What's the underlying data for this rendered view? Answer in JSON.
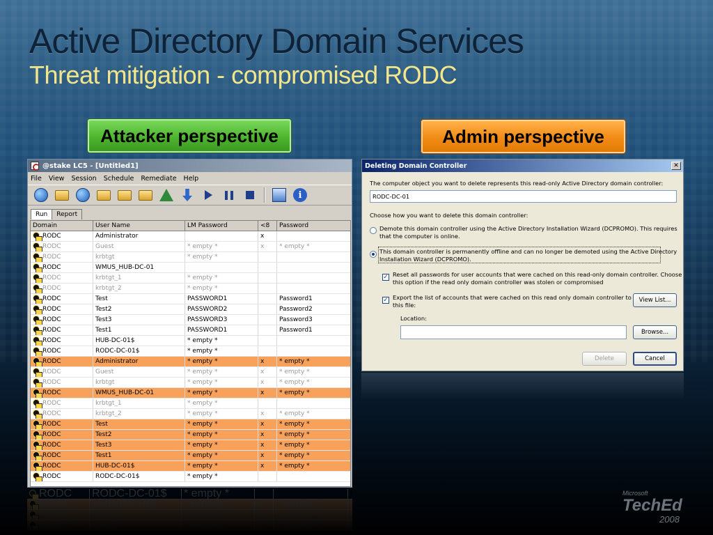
{
  "slide": {
    "title": "Active Directory Domain Services",
    "subtitle": "Threat mitigation - compromised RODC"
  },
  "badges": {
    "attacker": "Attacker perspective",
    "admin": "Admin perspective"
  },
  "colors": {
    "attacker_badge": "#4fb52f",
    "admin_badge": "#f28b16",
    "highlight_row": "#f7a15a"
  },
  "lc5": {
    "title": "@stake LC5 - [Untitled1]",
    "menu": [
      "File",
      "View",
      "Session",
      "Schedule",
      "Remediate",
      "Help"
    ],
    "toolbar_icons": [
      "new-session-icon",
      "open-session-icon",
      "save-icon",
      "import-icon",
      "export-icon",
      "session-options-icon",
      "remediate-icon",
      "download-icon",
      "play-icon",
      "pause-icon",
      "stop-icon",
      "report-icon",
      "info-icon"
    ],
    "tabs": [
      "Run",
      "Report"
    ],
    "columns": [
      "Domain",
      "User Name",
      "LM Password",
      "<8",
      "Password"
    ],
    "rows": [
      {
        "domain": "RODC",
        "user": "Administrator",
        "lm": "",
        "lt8": "x",
        "pw": "",
        "style": "normal"
      },
      {
        "domain": "RODC",
        "user": "Guest",
        "lm": "* empty *",
        "lt8": "x",
        "pw": "* empty *",
        "style": "grey"
      },
      {
        "domain": "RODC",
        "user": "krbtgt",
        "lm": "* empty *",
        "lt8": "",
        "pw": "",
        "style": "grey"
      },
      {
        "domain": "RODC",
        "user": "WMUS_HUB-DC-01",
        "lm": "",
        "lt8": "",
        "pw": "",
        "style": "normal"
      },
      {
        "domain": "RODC",
        "user": "krbtgt_1",
        "lm": "* empty *",
        "lt8": "",
        "pw": "",
        "style": "grey"
      },
      {
        "domain": "RODC",
        "user": "krbtgt_2",
        "lm": "* empty *",
        "lt8": "",
        "pw": "",
        "style": "grey"
      },
      {
        "domain": "RODC",
        "user": "Test",
        "lm": "PASSWORD1",
        "lt8": "",
        "pw": "Password1",
        "style": "normal"
      },
      {
        "domain": "RODC",
        "user": "Test2",
        "lm": "PASSWORD2",
        "lt8": "",
        "pw": "Password2",
        "style": "normal"
      },
      {
        "domain": "RODC",
        "user": "Test3",
        "lm": "PASSWORD3",
        "lt8": "",
        "pw": "Password3",
        "style": "normal"
      },
      {
        "domain": "RODC",
        "user": "Test1",
        "lm": "PASSWORD1",
        "lt8": "",
        "pw": "Password1",
        "style": "normal"
      },
      {
        "domain": "RODC",
        "user": "HUB-DC-01$",
        "lm": "* empty *",
        "lt8": "",
        "pw": "",
        "style": "normal"
      },
      {
        "domain": "RODC",
        "user": "RODC-DC-01$",
        "lm": "* empty *",
        "lt8": "",
        "pw": "",
        "style": "normal"
      },
      {
        "domain": "RODC",
        "user": "Administrator",
        "lm": "* empty *",
        "lt8": "x",
        "pw": "* empty *",
        "style": "hl"
      },
      {
        "domain": "RODC",
        "user": "Guest",
        "lm": "* empty *",
        "lt8": "x",
        "pw": "* empty *",
        "style": "grey"
      },
      {
        "domain": "RODC",
        "user": "krbtgt",
        "lm": "* empty *",
        "lt8": "x",
        "pw": "* empty *",
        "style": "grey"
      },
      {
        "domain": "RODC",
        "user": "WMUS_HUB-DC-01",
        "lm": "* empty *",
        "lt8": "x",
        "pw": "* empty *",
        "style": "hl"
      },
      {
        "domain": "RODC",
        "user": "krbtgt_1",
        "lm": "* empty *",
        "lt8": "",
        "pw": "",
        "style": "grey"
      },
      {
        "domain": "RODC",
        "user": "krbtgt_2",
        "lm": "* empty *",
        "lt8": "x",
        "pw": "* empty *",
        "style": "grey"
      },
      {
        "domain": "RODC",
        "user": "Test",
        "lm": "* empty *",
        "lt8": "x",
        "pw": "* empty *",
        "style": "hl"
      },
      {
        "domain": "RODC",
        "user": "Test2",
        "lm": "* empty *",
        "lt8": "x",
        "pw": "* empty *",
        "style": "hl"
      },
      {
        "domain": "RODC",
        "user": "Test3",
        "lm": "* empty *",
        "lt8": "x",
        "pw": "* empty *",
        "style": "hl"
      },
      {
        "domain": "RODC",
        "user": "Test1",
        "lm": "* empty *",
        "lt8": "x",
        "pw": "* empty *",
        "style": "hl"
      },
      {
        "domain": "RODC",
        "user": "HUB-DC-01$",
        "lm": "* empty *",
        "lt8": "x",
        "pw": "* empty *",
        "style": "hl"
      },
      {
        "domain": "RODC",
        "user": "RODC-DC-01$",
        "lm": "* empty *",
        "lt8": "",
        "pw": "",
        "style": "normal"
      }
    ]
  },
  "dialog": {
    "title": "Deleting Domain Controller",
    "intro": "The computer object you want to delete represents this read-only Active Directory domain controller:",
    "object_name": "RODC-DC-01",
    "choose": "Choose how you want to delete this domain controller:",
    "option1_line1": "Demote this domain controller using the Active Directory Installation Wizard (DCPROMO).  This requires",
    "option1_line2": "that the computer is online.",
    "option2_line1": "This domain controller is permanently offline and can no longer be demoted using the Active Directory",
    "option2_line2": "Installation Wizard (DCPROMO).",
    "reset_line1": "Reset all passwords for user accounts that were cached on this read-only domain controller.  Choose",
    "reset_line2": "this option if the read only domain controller was stolen or compromised",
    "export_line1": "Export the list of accounts that were cached on this read only domain controller to",
    "export_line2": "this file:",
    "view_list": "View List...",
    "location_label": "Location:",
    "location_value": "",
    "browse": "Browse...",
    "delete": "Delete",
    "cancel": "Cancel"
  },
  "logo": {
    "line1": "Microsoft",
    "line2": "TechEd",
    "line3": "2008"
  }
}
